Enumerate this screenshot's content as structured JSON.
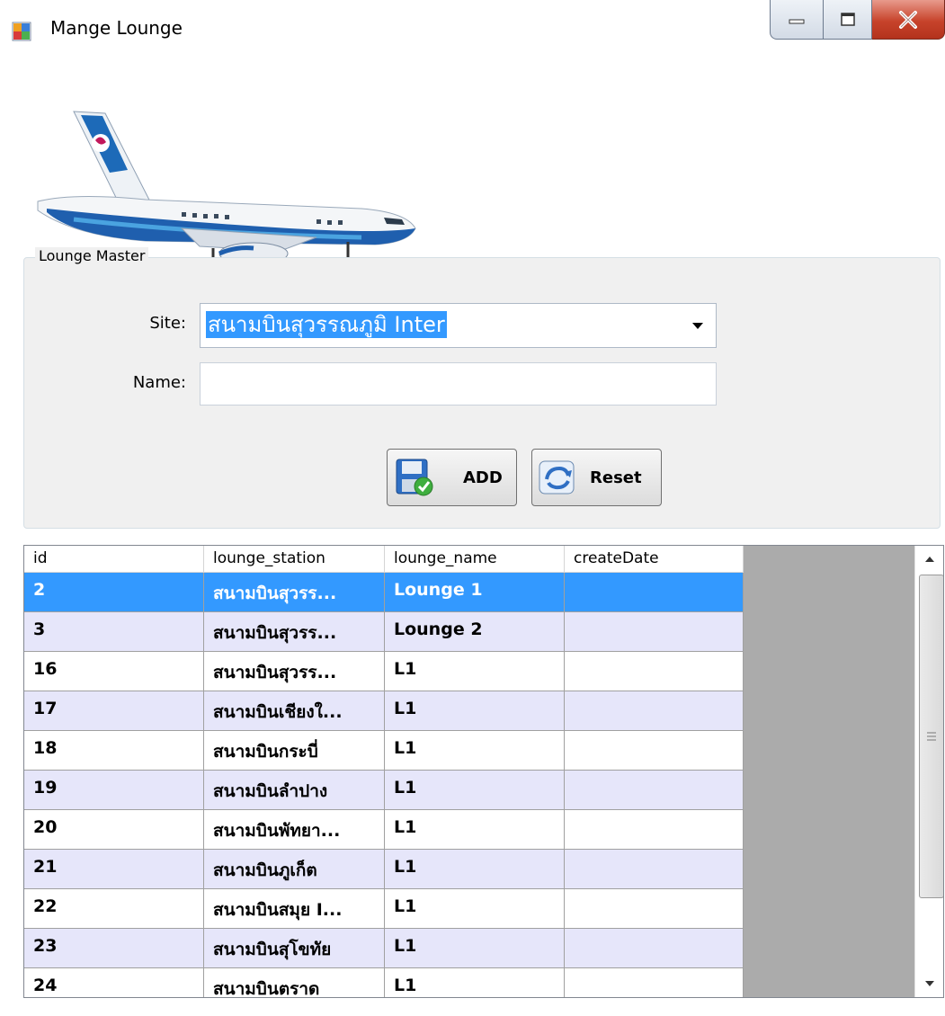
{
  "window": {
    "title": "Mange Lounge"
  },
  "group": {
    "title": "Lounge Master"
  },
  "form": {
    "site_label": "Site:",
    "site_value": "สนามบินสุวรรณภูมิ Inter",
    "name_label": "Name:",
    "name_value": ""
  },
  "buttons": {
    "add": "ADD",
    "reset": "Reset"
  },
  "grid": {
    "columns": [
      "id",
      "lounge_station",
      "lounge_name",
      "createDate"
    ],
    "rows": [
      {
        "id": "2",
        "lounge_station": "สนามบินสุวรร...",
        "lounge_name": "Lounge 1",
        "createDate": ""
      },
      {
        "id": "3",
        "lounge_station": "สนามบินสุวรร...",
        "lounge_name": "Lounge 2",
        "createDate": ""
      },
      {
        "id": "16",
        "lounge_station": "สนามบินสุวรร...",
        "lounge_name": "L1",
        "createDate": ""
      },
      {
        "id": "17",
        "lounge_station": "สนามบินเชียงใ...",
        "lounge_name": "L1",
        "createDate": ""
      },
      {
        "id": "18",
        "lounge_station": "สนามบินกระบี่",
        "lounge_name": "L1",
        "createDate": ""
      },
      {
        "id": "19",
        "lounge_station": "สนามบินลำปาง",
        "lounge_name": "L1",
        "createDate": ""
      },
      {
        "id": "20",
        "lounge_station": "สนามบินพัทยา...",
        "lounge_name": "L1",
        "createDate": ""
      },
      {
        "id": "21",
        "lounge_station": "สนามบินภูเก็ต",
        "lounge_name": "L1",
        "createDate": ""
      },
      {
        "id": "22",
        "lounge_station": "สนามบินสมุย I...",
        "lounge_name": "L1",
        "createDate": ""
      },
      {
        "id": "23",
        "lounge_station": "สนามบินสุโขทัย",
        "lounge_name": "L1",
        "createDate": ""
      },
      {
        "id": "24",
        "lounge_station": "สนามบินตราด",
        "lounge_name": "L1",
        "createDate": ""
      }
    ]
  },
  "colors": {
    "selection": "#3399ff",
    "alt_row": "#e6e6fa",
    "grid_background": "#ababab"
  }
}
